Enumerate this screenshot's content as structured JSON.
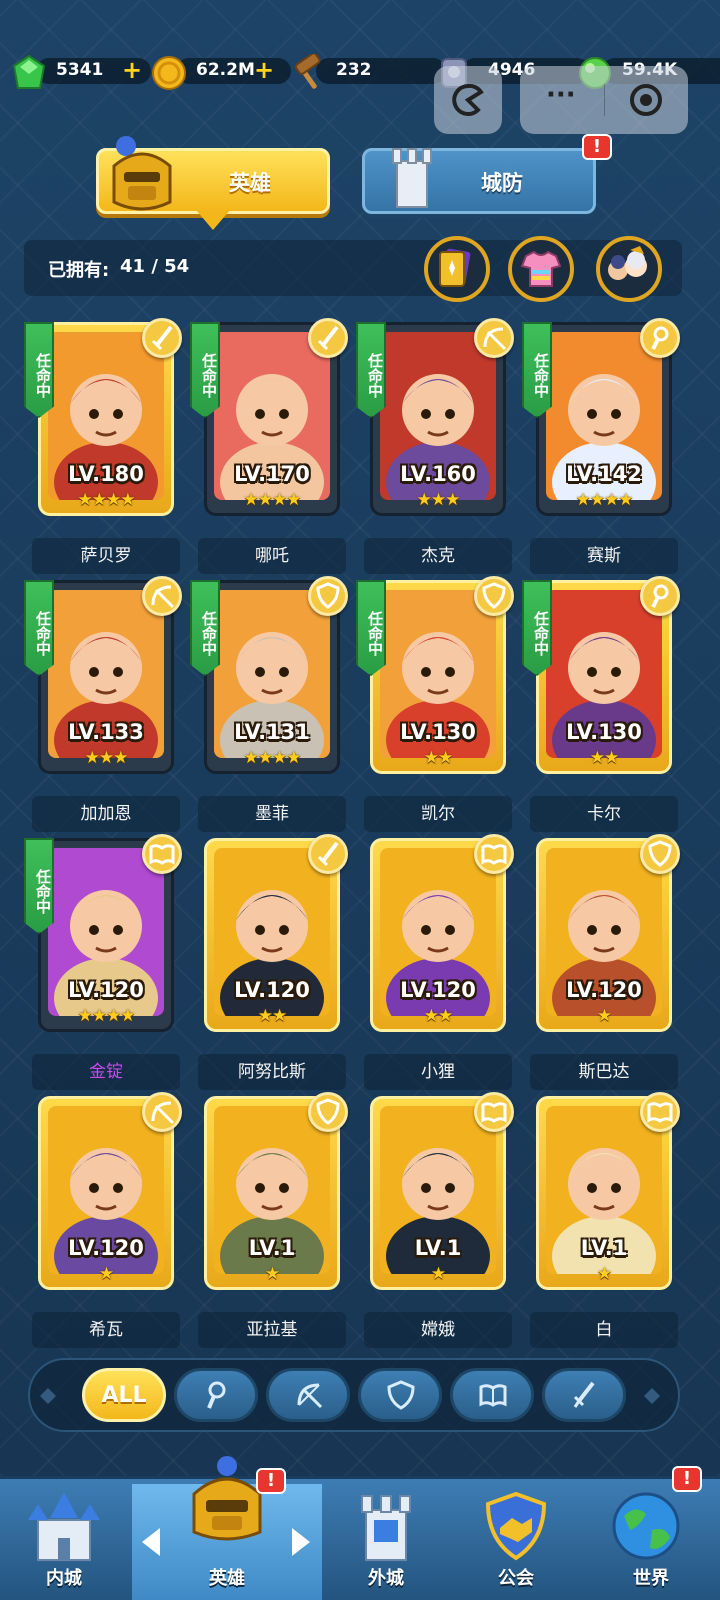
{
  "resources": {
    "gems": "5341",
    "gold": "62.2M",
    "hammers": "232",
    "tokens": "4946",
    "energy": "59.4K",
    "plus": "+"
  },
  "mini_program": {
    "more": "···"
  },
  "tabs": {
    "heroes": "英雄",
    "defense": "城防"
  },
  "alert_mark": "!",
  "owned": {
    "label": "已拥有:",
    "count": "41 / 54"
  },
  "heroes": [
    {
      "name": "萨贝罗",
      "level": "LV.180",
      "stars": "★★★★",
      "appointed": true,
      "class": "sword",
      "gold_frame": true
    },
    {
      "name": "哪吒",
      "level": "LV.170",
      "stars": "★★★★",
      "appointed": true,
      "class": "sword",
      "gold_frame": false
    },
    {
      "name": "杰克",
      "level": "LV.160",
      "stars": "★★★",
      "appointed": true,
      "class": "bow",
      "gold_frame": false
    },
    {
      "name": "赛斯",
      "level": "LV.142",
      "stars": "★★★★",
      "appointed": true,
      "class": "staff",
      "gold_frame": false
    },
    {
      "name": "加加恩",
      "level": "LV.133",
      "stars": "★★★",
      "appointed": true,
      "class": "bow",
      "gold_frame": false
    },
    {
      "name": "墨菲",
      "level": "LV.131",
      "stars": "★★★★",
      "appointed": true,
      "class": "shield",
      "gold_frame": false
    },
    {
      "name": "凯尔",
      "level": "LV.130",
      "stars": "★★",
      "appointed": true,
      "class": "shield",
      "gold_frame": true
    },
    {
      "name": "卡尔",
      "level": "LV.130",
      "stars": "★★",
      "appointed": true,
      "class": "staff",
      "gold_frame": true
    },
    {
      "name": "金锭",
      "level": "LV.120",
      "stars": "★★★★",
      "appointed": true,
      "class": "book",
      "gold_frame": false
    },
    {
      "name": "阿努比斯",
      "level": "LV.120",
      "stars": "★★",
      "appointed": false,
      "class": "sword",
      "gold_frame": true
    },
    {
      "name": "小狸",
      "level": "LV.120",
      "stars": "★★",
      "appointed": false,
      "class": "book",
      "gold_frame": true
    },
    {
      "name": "斯巴达",
      "level": "LV.120",
      "stars": "★",
      "appointed": false,
      "class": "shield",
      "gold_frame": true
    },
    {
      "name": "希瓦",
      "level": "LV.120",
      "stars": "★",
      "appointed": false,
      "class": "bow",
      "gold_frame": true
    },
    {
      "name": "亚拉基",
      "level": "LV.1",
      "stars": "★",
      "appointed": false,
      "class": "shield",
      "gold_frame": true
    },
    {
      "name": "嫦娥",
      "level": "LV.1",
      "stars": "★",
      "appointed": false,
      "class": "book",
      "gold_frame": true
    },
    {
      "name": "白",
      "level": "LV.1",
      "stars": "★",
      "appointed": false,
      "class": "book",
      "gold_frame": true
    }
  ],
  "appointed_label": "任命中",
  "filters": {
    "all": "ALL",
    "icons": [
      "staff-icon",
      "bow-icon",
      "shield-icon",
      "book-icon",
      "sword-icon"
    ]
  },
  "bottom_nav": [
    {
      "label": "内城",
      "icon": "castle-icon"
    },
    {
      "label": "英雄",
      "icon": "hero-helmet-icon"
    },
    {
      "label": "外城",
      "icon": "tower-icon"
    },
    {
      "label": "公会",
      "icon": "guild-handshake-icon"
    },
    {
      "label": "世界",
      "icon": "globe-icon"
    }
  ],
  "colors": {
    "accent_gold": "#f5c842",
    "appoint_green": "#3fbf5a",
    "alert_red": "#e8362e",
    "special_name": "#c24de8"
  }
}
